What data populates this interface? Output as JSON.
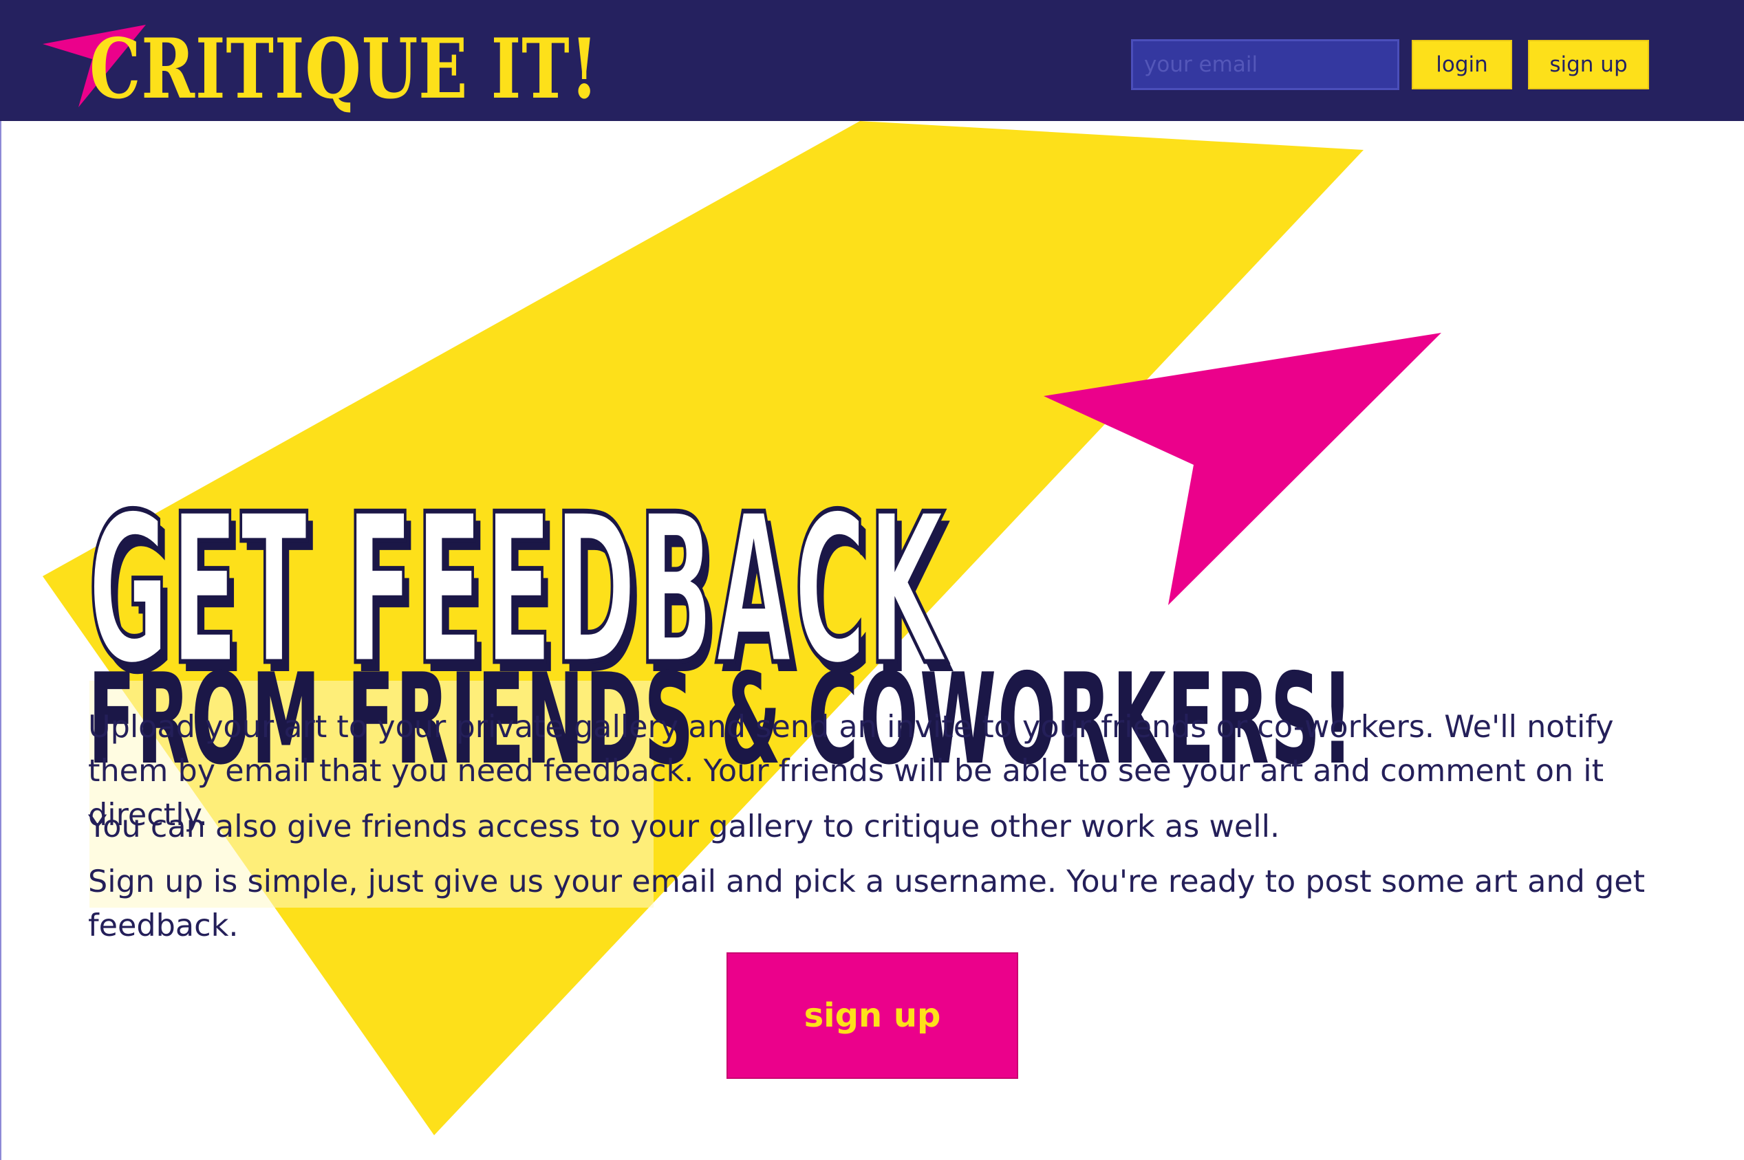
{
  "header": {
    "logo_text": "CRITIQUE IT!",
    "email_placeholder": "your email",
    "login_label": "login",
    "signup_label": "sign up"
  },
  "hero": {
    "headline_line1": "GET FEEDBACK",
    "headline_line2": "FROM FRIENDS & COWORKERS!",
    "paragraphs": [
      "Upload your art to your private gallery and send an invite to your friends or co-workers. We'll notify them by email that you need feedback. Your friends will be able to see your art and comment on it directly.",
      "You can also give friends access to your gallery to critique other work as well.",
      "Sign up is simple, just give us your email and pick a username. You're ready to post some art and get feedback."
    ],
    "cta_label": "sign up"
  },
  "colors": {
    "navy": "#25215f",
    "yellow": "#fde01a",
    "magenta": "#eb018b",
    "input_blue": "#3438a0",
    "text_dark": "#1b1747"
  },
  "icons": {
    "logo_mark": "star-icon",
    "decoration": "paper-plane-icon"
  }
}
